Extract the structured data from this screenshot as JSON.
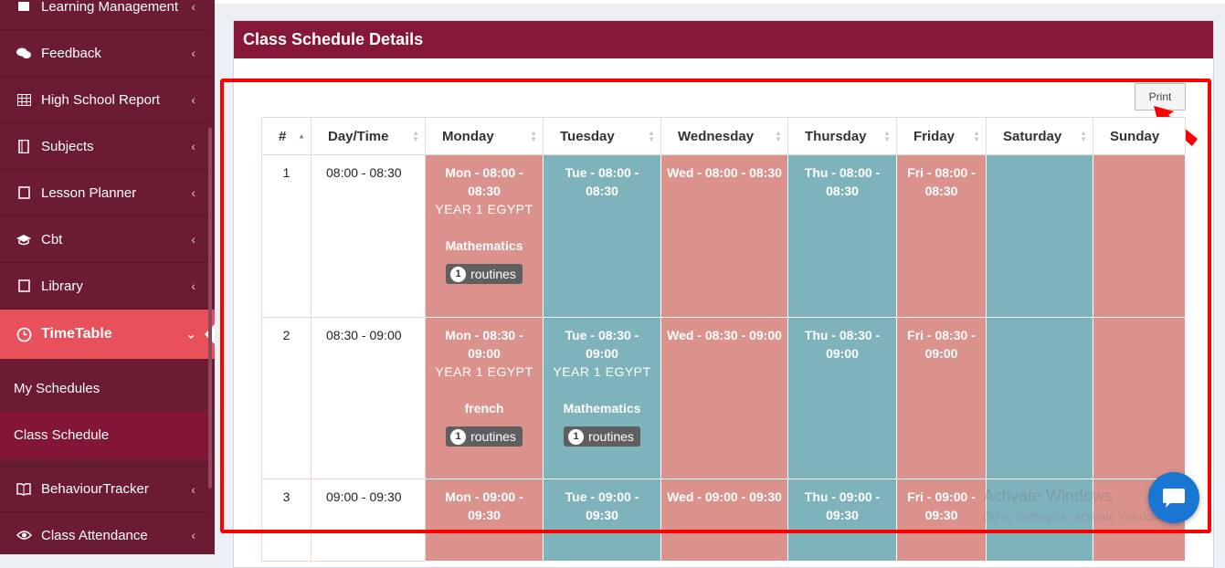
{
  "sidebar": {
    "items": [
      {
        "label": "Learning Management",
        "icon": "book-icon"
      },
      {
        "label": "Feedback",
        "icon": "comments-icon"
      },
      {
        "label": "High School Report",
        "icon": "table-icon"
      },
      {
        "label": "Subjects",
        "icon": "notebook-icon"
      },
      {
        "label": "Lesson Planner",
        "icon": "edit-icon"
      },
      {
        "label": "Cbt",
        "icon": "graduation-cap-icon"
      },
      {
        "label": "Library",
        "icon": "edit-icon"
      },
      {
        "label": "TimeTable",
        "icon": "clock-icon"
      },
      {
        "label": "BehaviourTracker",
        "icon": "open-book-icon"
      },
      {
        "label": "Class Attendance",
        "icon": "eye-icon"
      }
    ],
    "submenu": [
      {
        "label": "My Schedules"
      },
      {
        "label": "Class Schedule"
      }
    ]
  },
  "panel": {
    "title": "Class Schedule Details",
    "print_label": "Print"
  },
  "table": {
    "headers": [
      "#",
      "Day/Time",
      "Monday",
      "Tuesday",
      "Wednesday",
      "Thursday",
      "Friday",
      "Saturday",
      "Sunday"
    ],
    "rows": [
      {
        "num": "1",
        "time": "08:00 - 08:30",
        "mon": {
          "time": "Mon - 08:00 - 08:30",
          "class": "YEAR 1 EGYPT",
          "subject": "Mathematics",
          "badge_count": "1",
          "badge_label": "routines"
        },
        "tue": {
          "time": "Tue - 08:00 - 08:30"
        },
        "wed": {
          "time": "Wed - 08:00 - 08:30"
        },
        "thu": {
          "time": "Thu - 08:00 - 08:30"
        },
        "fri": {
          "time": "Fri - 08:00 - 08:30"
        }
      },
      {
        "num": "2",
        "time": "08:30 - 09:00",
        "mon": {
          "time": "Mon - 08:30 - 09:00",
          "class": "YEAR 1 EGYPT",
          "subject": "french",
          "badge_count": "1",
          "badge_label": "routines"
        },
        "tue": {
          "time": "Tue - 08:30 - 09:00",
          "class": "YEAR 1 EGYPT",
          "subject": "Mathematics",
          "badge_count": "1",
          "badge_label": "routines"
        },
        "wed": {
          "time": "Wed - 08:30 - 09:00"
        },
        "thu": {
          "time": "Thu - 08:30 - 09:00"
        },
        "fri": {
          "time": "Fri - 08:30 - 09:00"
        }
      },
      {
        "num": "3",
        "time": "09:00 - 09:30",
        "mon": {
          "time": "Mon - 09:00 - 09:30"
        },
        "tue": {
          "time": "Tue - 09:00 - 09:30"
        },
        "wed": {
          "time": "Wed - 09:00 - 09:30"
        },
        "thu": {
          "time": "Thu - 09:00 - 09:30"
        },
        "fri": {
          "time": "Fri - 09:00 - 09:30"
        }
      }
    ]
  },
  "colors": {
    "sidebar_bg": "#6b1b32",
    "active_bg": "#e8505b",
    "panel_header": "#861737",
    "pink_cell": "#dc928c",
    "teal_cell": "#7fb3bb",
    "annotation_red": "#ff0000",
    "chat_blue": "#1976d2"
  },
  "overlay": {
    "watermark_line1": "Activate Windows",
    "watermark_line2": "Go to Settings to activate Windows."
  }
}
